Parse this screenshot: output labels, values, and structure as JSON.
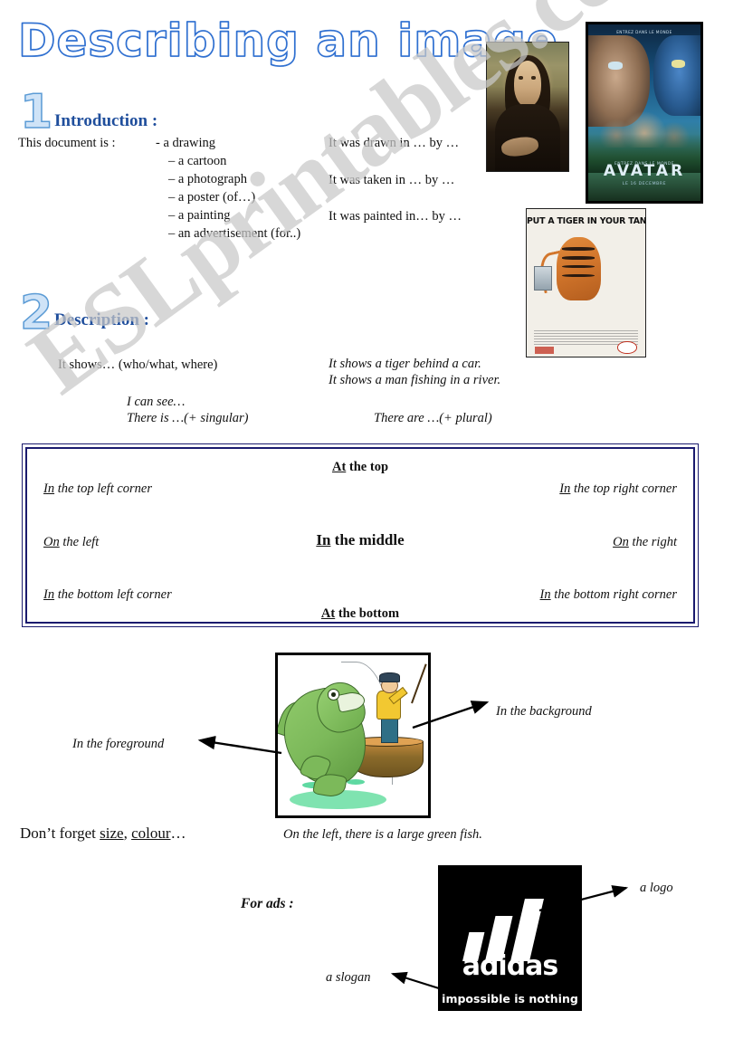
{
  "document": {
    "title": "Describing an image",
    "watermark": "ESLprintables.com"
  },
  "section1": {
    "number": "1",
    "heading": "Introduction :",
    "lead": "This document is  :",
    "types": [
      "- a drawing",
      "– a cartoon",
      "– a photograph",
      "– a poster (of…)",
      "– a painting",
      "– an advertisement (for..)"
    ],
    "passives": [
      "It was drawn in … by …",
      "It was taken in … by …",
      "It was painted in… by …"
    ]
  },
  "section2": {
    "number": "2",
    "heading": "Description :",
    "prompt": "It shows… (who/what, where)",
    "examples": [
      "It shows a tiger behind a car.",
      "It shows a man fishing in a river."
    ],
    "i_can_see": "I can see…",
    "there_is": "There is …(+ singular)",
    "there_are": "There are …(+ plural)"
  },
  "position_box": {
    "top": {
      "underlined": "At",
      "rest": " the top"
    },
    "top_left": {
      "underlined": "In",
      "rest": " the top left corner"
    },
    "top_right": {
      "underlined": "In",
      "rest": " the top right corner"
    },
    "left": {
      "underlined": "On",
      "rest": " the left"
    },
    "middle": {
      "underlined": "In",
      "rest": " the middle"
    },
    "right": {
      "underlined": "On",
      "rest": " the right"
    },
    "bottom_left": {
      "underlined": "In",
      "rest": " the bottom left corner"
    },
    "bottom_right": {
      "underlined": "In",
      "rest": " the bottom right corner"
    },
    "bottom": {
      "underlined": "At",
      "rest": " the bottom"
    }
  },
  "fishing": {
    "foreground_label": "In the foreground",
    "background_label": "In the background",
    "caption": "On the left, there is a large green fish.",
    "dont_forget_prefix": "Don’t forget ",
    "dont_forget_word1": "size",
    "dont_forget_sep": ", ",
    "dont_forget_word2": "colour",
    "dont_forget_suffix": "…"
  },
  "ads": {
    "label": "For ads :",
    "logo_label": "a logo",
    "slogan_label": "a slogan",
    "brand": "adidas",
    "brand_slogan": "impossible is nothing"
  },
  "images": {
    "mona_lisa": "mona-lisa-painting",
    "avatar_poster": {
      "name": "avatar-movie-poster",
      "tagline": "ENTREZ DANS LE MONDE",
      "title": "AVATAR",
      "release": "LE 16 DECEMBRE",
      "above_title": "ENTREZ DANS LE MONDE"
    },
    "esso_poster": {
      "name": "esso-tiger-poster",
      "headline": "PUT A TIGER IN YOUR TANK!"
    },
    "fishing_picture": "man-fishing-cartoon",
    "adidas_ad": "adidas-advertisement"
  },
  "colors": {
    "title_outline": "#2f6fd0",
    "heading_blue": "#1f4e9c",
    "number_fill": "#cfe3f7",
    "box_border": "#1a1a6e",
    "watermark": "#c9c9c9"
  }
}
